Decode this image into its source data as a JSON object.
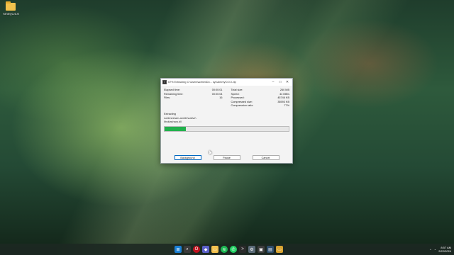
{
  "desktop": {
    "icons": [
      {
        "label": "Ammy1.0.0",
        "icon": "folder-icon"
      }
    ]
  },
  "dialog": {
    "title": "67% Extracting C:\\Users\\admin\\Do... sys\\Ammy\\0.0.0.zip",
    "app_icon": "7-zip-icon",
    "window_buttons": {
      "minimize": "–",
      "maximize": "□",
      "close": "✕"
    },
    "left_stats": [
      {
        "label": "Elapsed time:",
        "value": "00:00:01"
      },
      {
        "label": "Remaining time:",
        "value": "00:00:04"
      },
      {
        "label": "Files:",
        "value": "16"
      }
    ],
    "right_stats": [
      {
        "label": "Total size:",
        "value": "260 MB"
      },
      {
        "label": "Speed:",
        "value": "44 MB/s"
      },
      {
        "label": "Processed:",
        "value": "45746 KB"
      },
      {
        "label": "Compressed size:",
        "value": "35593 KB"
      },
      {
        "label": "Compression ratio:",
        "value": "77%"
      }
    ],
    "extracting_label": "Extracting",
    "current_path_line1": "runtimes\\win-arm64\\native\\",
    "current_path_line2": "libskiasharp.dll",
    "progress_fraction": 0.17,
    "buttons": {
      "background": "Background",
      "pause": "Pause",
      "cancel": "Cancel"
    }
  },
  "taskbar": {
    "icons": [
      "windows-start-icon",
      "search-icon",
      "opera-browser-icon",
      "chat-icon",
      "file-explorer-icon",
      "spotify-icon",
      "whatsapp-icon",
      "terminal-icon",
      "settings-icon",
      "app-icon",
      "vm-icon",
      "explorer-icon"
    ],
    "tray": {
      "chevron": "^",
      "time": "8:57 AM",
      "date": "2/22/2024"
    }
  },
  "colors": {
    "progress": "#22b14c",
    "accent": "#0067c0"
  }
}
